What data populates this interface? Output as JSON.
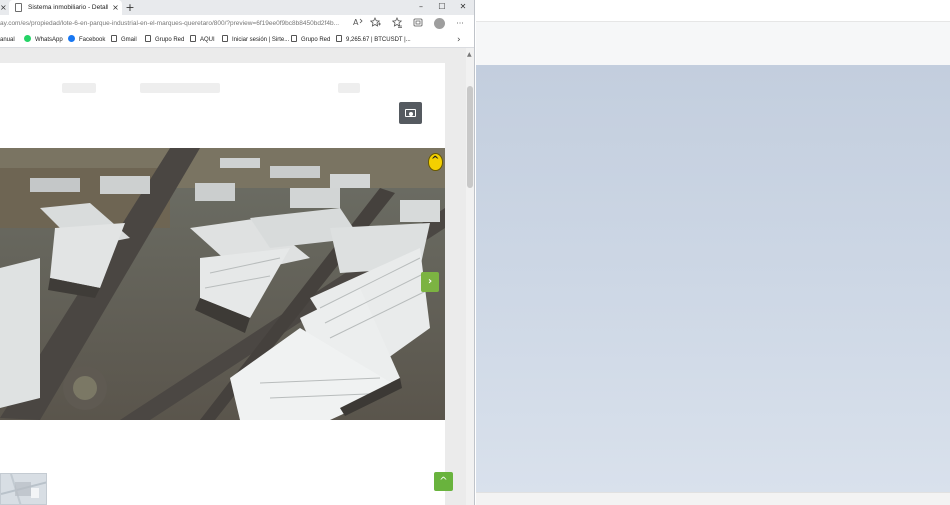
{
  "browser": {
    "tab_title": "Sistema inmobiliario - Detalle d",
    "new_tab_symbol": "+",
    "tab_close_symbol": "×",
    "partial_tab_close_symbol": "×",
    "window_controls": {
      "minimize": "–",
      "maximize": "☐",
      "close": "✕"
    },
    "url_visible": "ay.com/es/propiedad/lote-6-en-parque-industrial-en-el-marques-queretaro/800/?preview=6f19ee0f9bc8b8450bd2f4b...",
    "toolbar_icons": [
      "read-aloud-icon",
      "add-favorite-icon",
      "favorites-icon",
      "collections-icon",
      "profile-icon",
      "more-icon"
    ],
    "more_symbol": "···",
    "bookmarks": [
      {
        "label": "anual",
        "icon": "page-icon"
      },
      {
        "label": "WhatsApp",
        "icon": "whatsapp-icon"
      },
      {
        "label": "Facebook",
        "icon": "facebook-icon"
      },
      {
        "label": "Gmail",
        "icon": "page-icon"
      },
      {
        "label": "Grupo Red",
        "icon": "page-icon"
      },
      {
        "label": "AQUI",
        "icon": "page-icon"
      },
      {
        "label": "Iniciar sesión | Sirte...",
        "icon": "page-icon"
      },
      {
        "label": "Grupo Red",
        "icon": "page-icon"
      },
      {
        "label": "9,265.67 | BTCUSDT |...",
        "icon": "page-icon"
      }
    ],
    "bookmarks_more_symbol": "›"
  },
  "page": {
    "next_arrow": "›",
    "top_arrow": "^",
    "badge_symbol": "^"
  },
  "colors": {
    "accent_green": "#7cb342",
    "camera_button": "#555a60",
    "badge_yellow": "#f4d000",
    "desktop_gradient_top": "#c3cede",
    "desktop_gradient_bottom": "#d9e1ec"
  }
}
